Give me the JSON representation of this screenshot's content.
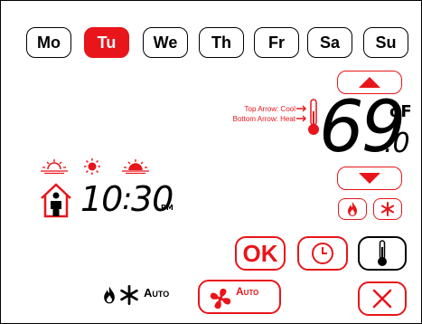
{
  "days": [
    {
      "label": "Mo",
      "active": false
    },
    {
      "label": "Tu",
      "active": true
    },
    {
      "label": "We",
      "active": false
    },
    {
      "label": "Th",
      "active": false
    },
    {
      "label": "Fr",
      "active": false
    },
    {
      "label": "Sa",
      "active": false
    },
    {
      "label": "Su",
      "active": false
    }
  ],
  "thermostat": {
    "cool_hint": "Top Arrow: Cool",
    "heat_hint": "Bottom Arrow: Heat",
    "temperature": "69",
    "temperature_decimal": ".0",
    "unit": "oF"
  },
  "schedule": {
    "time_hours": "10",
    "time_colon": ":",
    "time_minutes": "30",
    "ampm": "PM",
    "period_icons": [
      "sunrise-icon",
      "sun-icon",
      "sunset-icon",
      "moon-icon"
    ]
  },
  "mode": {
    "status_label": "Auto",
    "fan_button_label": "Auto",
    "ok_label": "OK"
  },
  "colors": {
    "accent": "#e8151a",
    "text": "#000000"
  }
}
